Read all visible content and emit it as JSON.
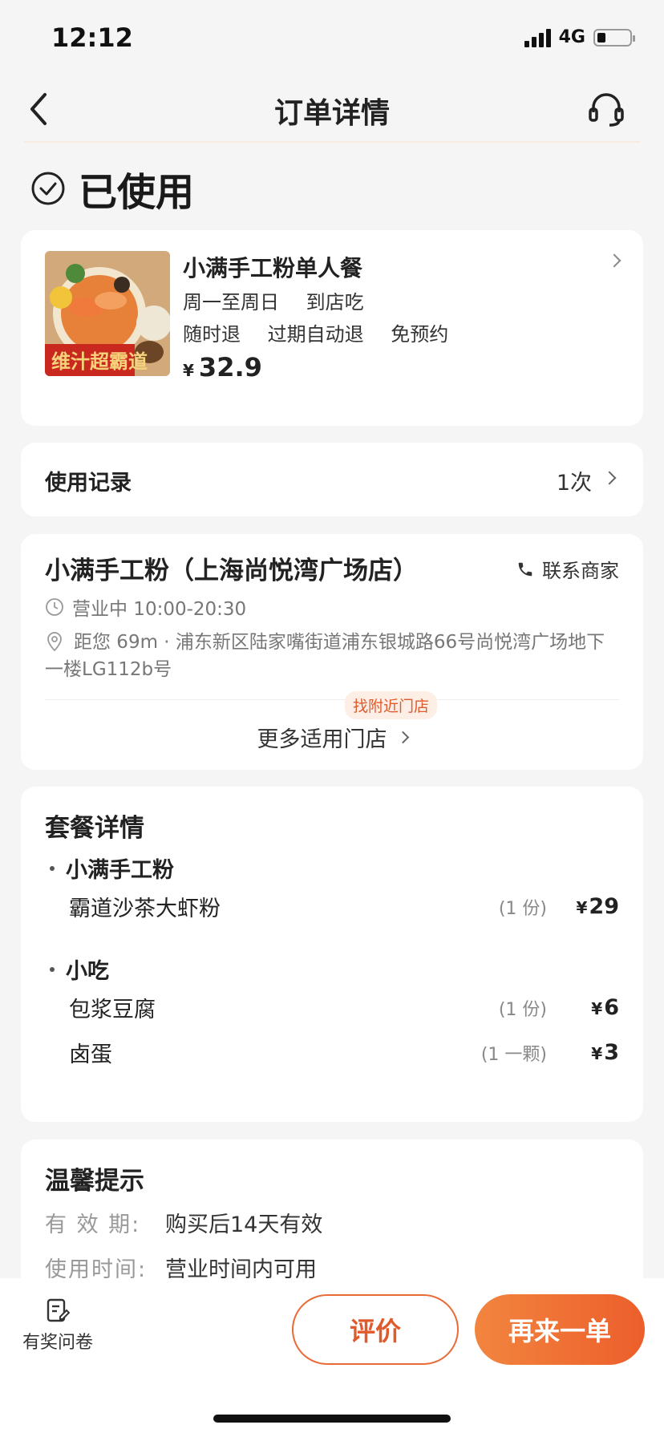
{
  "status_bar": {
    "time": "12:12",
    "network": "4G",
    "battery_level": 0.25
  },
  "nav": {
    "title": "订单详情"
  },
  "order_status": {
    "text": "已使用"
  },
  "product": {
    "name": "小满手工粉单人餐",
    "days": "周一至周日",
    "dine": "到店吃",
    "tags": [
      "随时退",
      "过期自动退",
      "免预约"
    ],
    "currency": "¥",
    "price": "32.9"
  },
  "usage_records": {
    "label": "使用记录",
    "count": "1次"
  },
  "store": {
    "name": "小满手工粉（上海尚悦湾广场店）",
    "contact_label": "联系商家",
    "hours": "营业中 10:00-20:30",
    "address": "距您 69m · 浦东新区陆家嘴街道浦东银城路66号尚悦湾广场地下一楼LG112b号",
    "nearby_badge": "找附近门店",
    "more_stores": "更多适用门店"
  },
  "package": {
    "title": "套餐详情",
    "groups": [
      {
        "name": "小满手工粉",
        "items": [
          {
            "name": "霸道沙茶大虾粉",
            "qty": "(1 份)",
            "price": "29"
          }
        ]
      },
      {
        "name": "小吃",
        "items": [
          {
            "name": "包浆豆腐",
            "qty": "(1 份)",
            "price": "6"
          },
          {
            "name": "卤蛋",
            "qty": "(1 一颗)",
            "price": "3"
          }
        ]
      }
    ],
    "currency": "¥"
  },
  "tips": {
    "title": "温馨提示",
    "rows": [
      {
        "key": "有 效 期:",
        "value": "购买后14天有效"
      },
      {
        "key": "使用时间:",
        "value": "营业时间内可用"
      }
    ]
  },
  "bottom_bar": {
    "survey_label": "有奖问卷",
    "review_button": "评价",
    "reorder_button": "再来一单"
  },
  "colors": {
    "accent": "#EC5E2B",
    "accent_light": "#F2853F",
    "background": "#F5F5F5"
  }
}
